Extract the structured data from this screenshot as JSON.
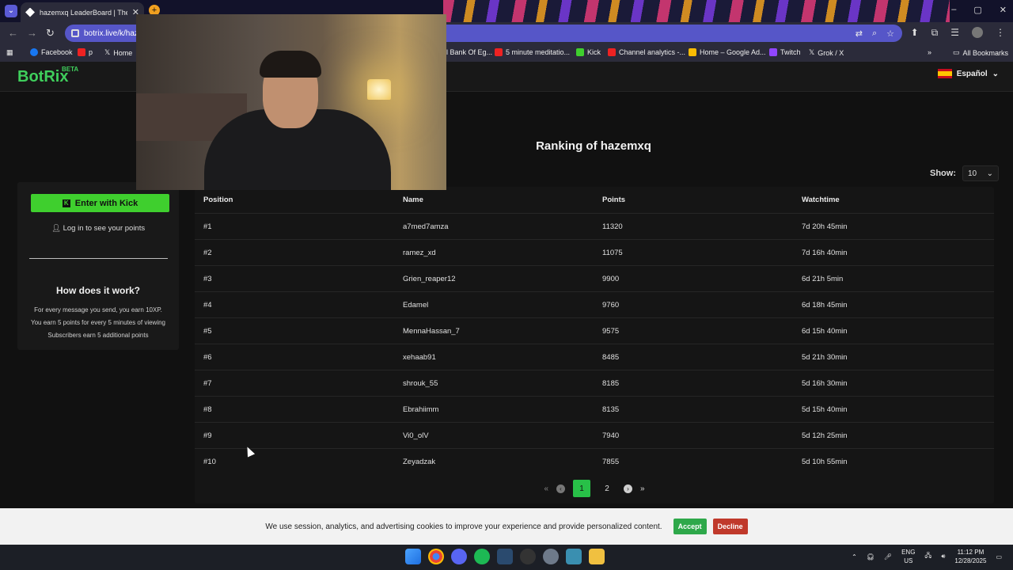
{
  "browser": {
    "tab_title": "hazemxq LeaderBoard | The be",
    "url": "botrix.live/k/haz",
    "bookmarks": [
      "Facebook",
      "p",
      "Home",
      "l Bank Of Eg...",
      "5 minute meditatio...",
      "Kick",
      "Channel analytics -...",
      "Home – Google Ad...",
      "Twitch",
      "Grok / X",
      "All Bookmarks"
    ]
  },
  "header": {
    "logo": "BotRix",
    "beta": "BETA",
    "language": "Español"
  },
  "main": {
    "title": "Ranking of hazemxq",
    "show_label": "Show:",
    "show_value": "10"
  },
  "sidebar": {
    "kick_button": "Enter with Kick",
    "login_text": "Log in to see your points",
    "how_title": "How does it work?",
    "rules": [
      "For every message you send, you earn 10XP.",
      "You earn 5 points for every 5 minutes of viewing",
      "Subscribers earn 5 additional points"
    ]
  },
  "table": {
    "columns": [
      "Position",
      "Name",
      "Points",
      "Watchtime"
    ],
    "rows": [
      [
        "#1",
        "a7med7amza",
        "11320",
        "7d 20h 45min"
      ],
      [
        "#2",
        "ramez_xd",
        "11075",
        "7d 16h 40min"
      ],
      [
        "#3",
        "Grien_reaper12",
        "9900",
        "6d 21h 5min"
      ],
      [
        "#4",
        "Edamel",
        "9760",
        "6d 18h 45min"
      ],
      [
        "#5",
        "MennaHassan_7",
        "9575",
        "6d 15h 40min"
      ],
      [
        "#6",
        "xehaab91",
        "8485",
        "5d 21h 30min"
      ],
      [
        "#7",
        "shrouk_55",
        "8185",
        "5d 16h 30min"
      ],
      [
        "#8",
        "Ebrahiimm",
        "8135",
        "5d 15h 40min"
      ],
      [
        "#9",
        "Vi0_olV",
        "7940",
        "5d 12h 25min"
      ],
      [
        "#10",
        "Zeyadzak",
        "7855",
        "5d 10h 55min"
      ]
    ]
  },
  "pagination": {
    "first": "«",
    "prev": "‹",
    "pages": [
      "1",
      "2"
    ],
    "current": "1",
    "next": "›",
    "last": "»"
  },
  "cookie": {
    "text": "We use session, analytics, and advertising cookies to improve your experience and provide personalized content.",
    "accept": "Accept",
    "decline": "Decline"
  },
  "taskbar": {
    "lang_top": "ENG",
    "lang_bottom": "US",
    "time": "11:12 PM",
    "date": "12/28/2025"
  },
  "colors": {
    "accent": "#3fcf5c",
    "kick": "#3fcf2e",
    "accept": "#2ea84a",
    "decline": "#c0392b"
  }
}
